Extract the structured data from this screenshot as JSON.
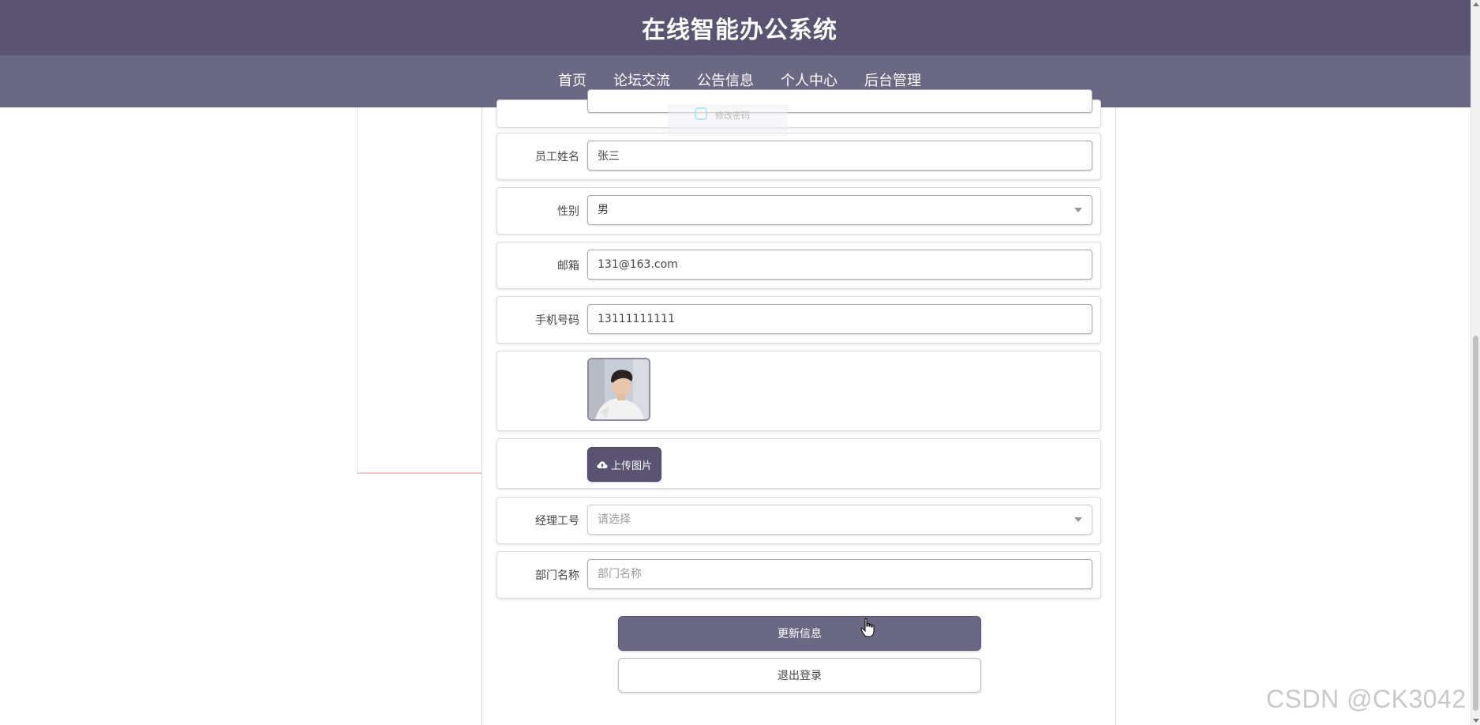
{
  "header": {
    "title": "在线智能办公系统"
  },
  "nav": {
    "items": [
      {
        "label": "首页",
        "active": false
      },
      {
        "label": "论坛交流",
        "active": false
      },
      {
        "label": "公告信息",
        "active": false
      },
      {
        "label": "个人中心",
        "active": true
      },
      {
        "label": "后台管理",
        "active": false
      }
    ]
  },
  "form": {
    "ghost_text": "修改密码",
    "employee_name": {
      "label": "员工姓名",
      "value": "张三"
    },
    "gender": {
      "label": "性别",
      "value": "男"
    },
    "email": {
      "label": "邮箱",
      "value": "131@163.com"
    },
    "phone": {
      "label": "手机号码",
      "value": "13111111111"
    },
    "upload_button": "上传图片",
    "manager_id": {
      "label": "经理工号",
      "placeholder": "请选择"
    },
    "department": {
      "label": "部门名称",
      "placeholder": "部门名称"
    }
  },
  "actions": {
    "update_label": "更新信息",
    "logout_label": "退出登录"
  },
  "watermark": "CSDN @CK3042"
}
